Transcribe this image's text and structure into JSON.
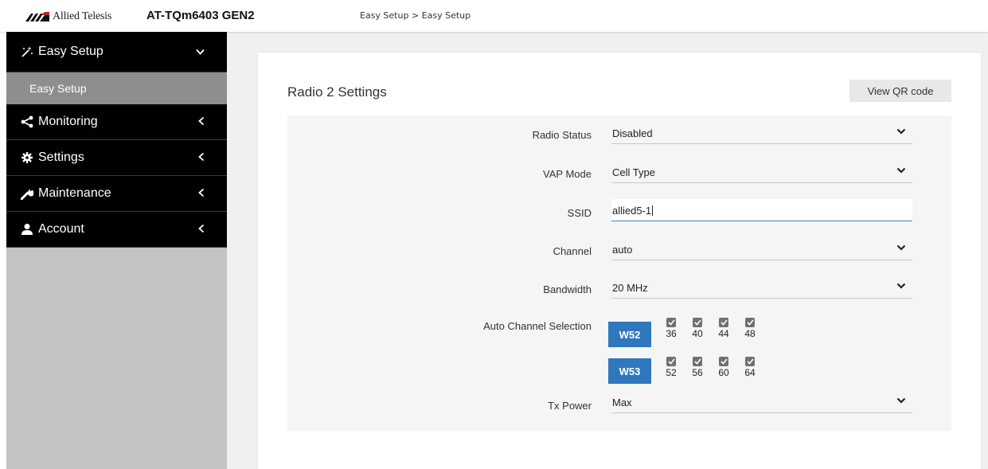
{
  "header": {
    "brand": "Allied Telesis",
    "model": "AT-TQm6403 GEN2",
    "breadcrumb": "Easy Setup > Easy Setup"
  },
  "sidebar": {
    "items": [
      {
        "label": "Easy Setup",
        "icon": "magic-wand-icon"
      },
      {
        "label": "Monitoring",
        "icon": "share-icon"
      },
      {
        "label": "Settings",
        "icon": "gear-icon"
      },
      {
        "label": "Maintenance",
        "icon": "wrench-icon"
      },
      {
        "label": "Account",
        "icon": "user-icon"
      }
    ],
    "sub_item": "Easy Setup"
  },
  "main": {
    "title": "Radio 2 Settings",
    "qr_button": "View QR code",
    "fields": {
      "radio_status": {
        "label": "Radio Status",
        "value": "Disabled"
      },
      "vap_mode": {
        "label": "VAP Mode",
        "value": "Cell Type"
      },
      "ssid": {
        "label": "SSID",
        "value": "allied5-1"
      },
      "channel": {
        "label": "Channel",
        "value": "auto"
      },
      "bandwidth": {
        "label": "Bandwidth",
        "value": "20 MHz"
      },
      "tx_power": {
        "label": "Tx Power",
        "value": "Max"
      }
    },
    "auto_channel": {
      "label": "Auto Channel Selection",
      "groups": [
        {
          "button": "W52",
          "channels": [
            {
              "num": "36",
              "checked": true
            },
            {
              "num": "40",
              "checked": true
            },
            {
              "num": "44",
              "checked": true
            },
            {
              "num": "48",
              "checked": true
            }
          ]
        },
        {
          "button": "W53",
          "channels": [
            {
              "num": "52",
              "checked": true
            },
            {
              "num": "56",
              "checked": true
            },
            {
              "num": "60",
              "checked": true
            },
            {
              "num": "64",
              "checked": true
            }
          ]
        }
      ]
    }
  },
  "colors": {
    "sidebar_active": "#000000",
    "sidebar_sub": "#8e8e8e",
    "accent_blue": "#2f78bd",
    "input_focus": "#3a86c4"
  }
}
